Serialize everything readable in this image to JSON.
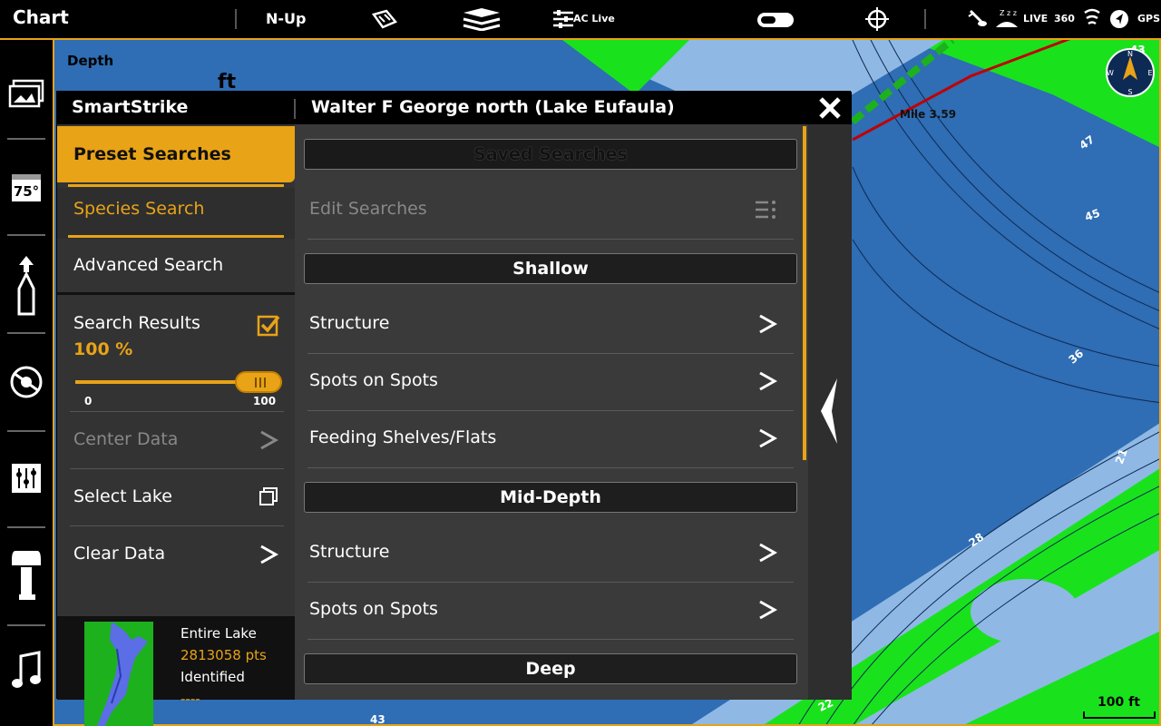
{
  "topbar": {
    "title": "Chart",
    "orientation": "N-Up",
    "ac_live": "AC Live",
    "live": "LIVE",
    "deg360": "360",
    "gps": "GPS"
  },
  "map": {
    "depth_label": "Depth",
    "depth_unit": "ft",
    "mile_label": "Mile 3.59",
    "scale": "100 ft",
    "compass": {
      "n": "N",
      "s": "S",
      "e": "E",
      "w": "W"
    },
    "depth_numbers": [
      "47",
      "45",
      "36",
      "21",
      "28",
      "22",
      "43",
      "43"
    ],
    "colors": {
      "deep": "#2f6db4",
      "mid": "#5d93cf",
      "shallow": "#8fb9e4",
      "land": "#19e21d",
      "route": "#c00000"
    }
  },
  "leftbar": {
    "temp": "75°"
  },
  "dialog": {
    "brand": "SmartStrike",
    "lake_title": "Walter F George north (Lake Eufaula)",
    "tabs": {
      "preset": "Preset Searches",
      "species": "Species Search",
      "advanced": "Advanced Search"
    },
    "search_results": {
      "label": "Search Results",
      "value": "100 %",
      "slider_min": "0",
      "slider_max": "100",
      "slider_fraction": 1.0
    },
    "left_rows": {
      "center": "Center Data",
      "select": "Select Lake",
      "clear": "Clear Data"
    },
    "lake_info": {
      "scope": "Entire Lake",
      "points": "2813058 pts",
      "identified": "Identified",
      "identified_value": "----"
    },
    "right": {
      "saved_header": "Saved Searches",
      "edit": "Edit Searches",
      "shallow_header": "Shallow",
      "shallow": [
        "Structure",
        "Spots on Spots",
        "Feeding Shelves/Flats"
      ],
      "mid_header": "Mid-Depth",
      "mid": [
        "Structure",
        "Spots on Spots"
      ],
      "deep_header": "Deep"
    },
    "accent": "#e8a317"
  }
}
